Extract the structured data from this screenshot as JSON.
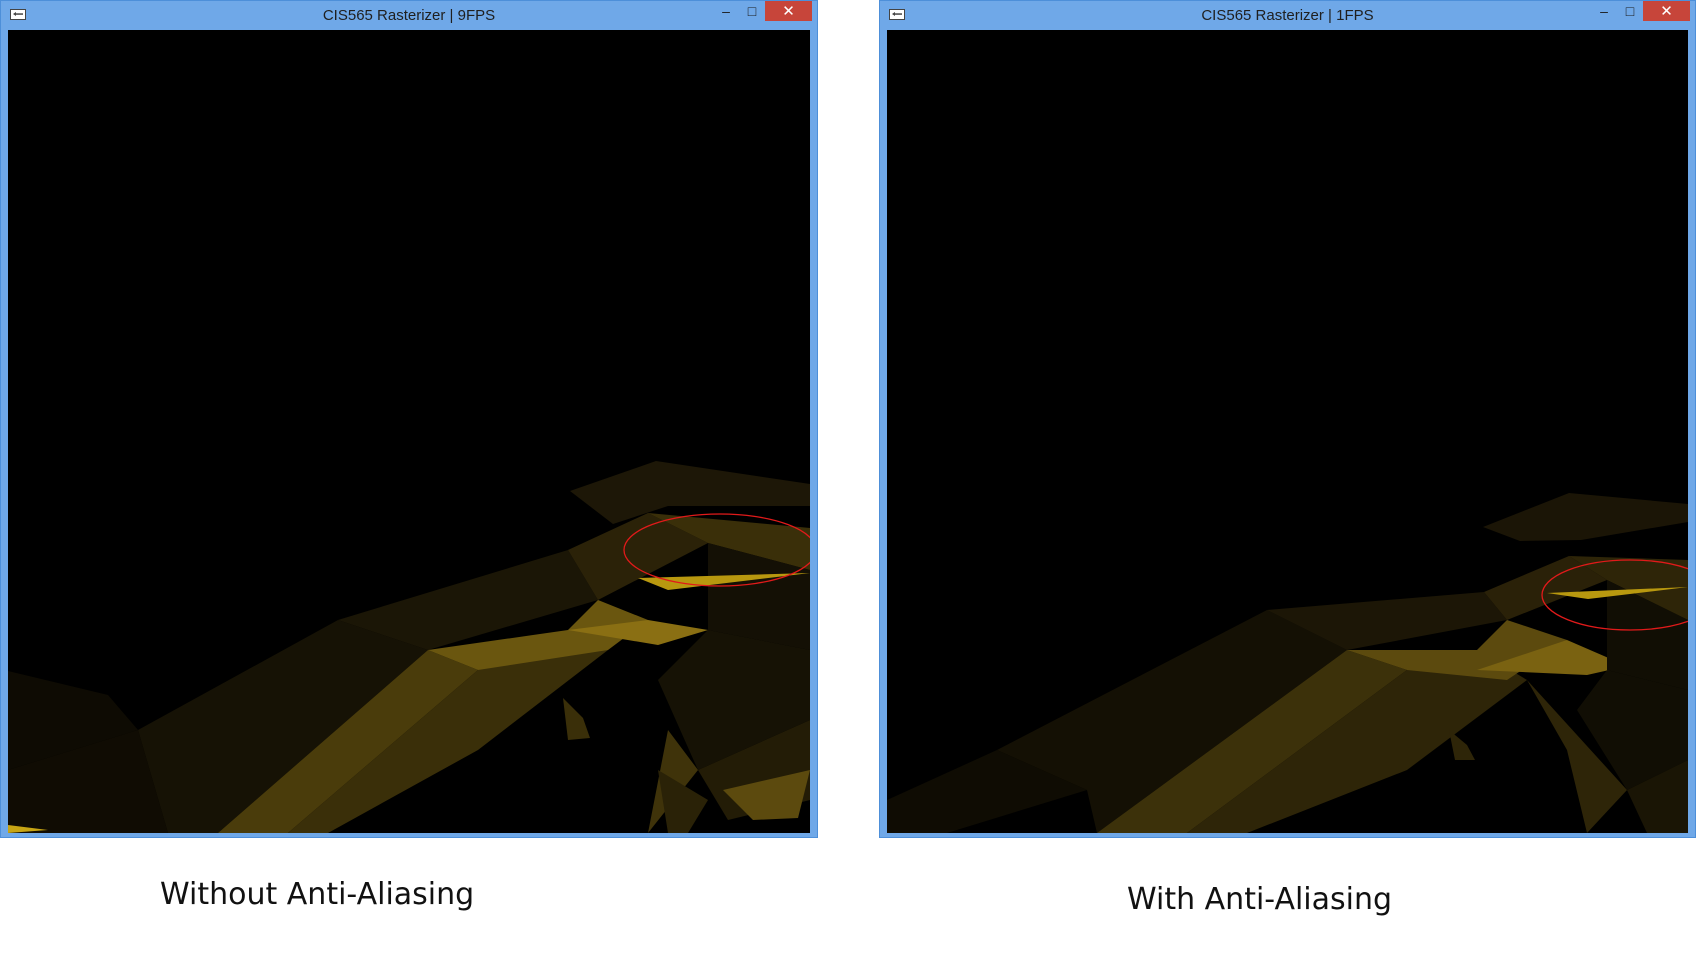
{
  "windows": [
    {
      "title": "CIS565 Rasterizer | 9FPS",
      "caption": "Without Anti-Aliasing"
    },
    {
      "title": "CIS565 Rasterizer | 1FPS",
      "caption": "With Anti-Aliasing"
    }
  ],
  "buttons": {
    "minimize": "–",
    "maximize": "□",
    "close": "✕"
  },
  "colors": {
    "frame": "#6fa8e8",
    "close": "#c7453a",
    "canvas": "#000000",
    "mesh": "#b8980f",
    "highlight_ellipse": "#e11a1a"
  }
}
